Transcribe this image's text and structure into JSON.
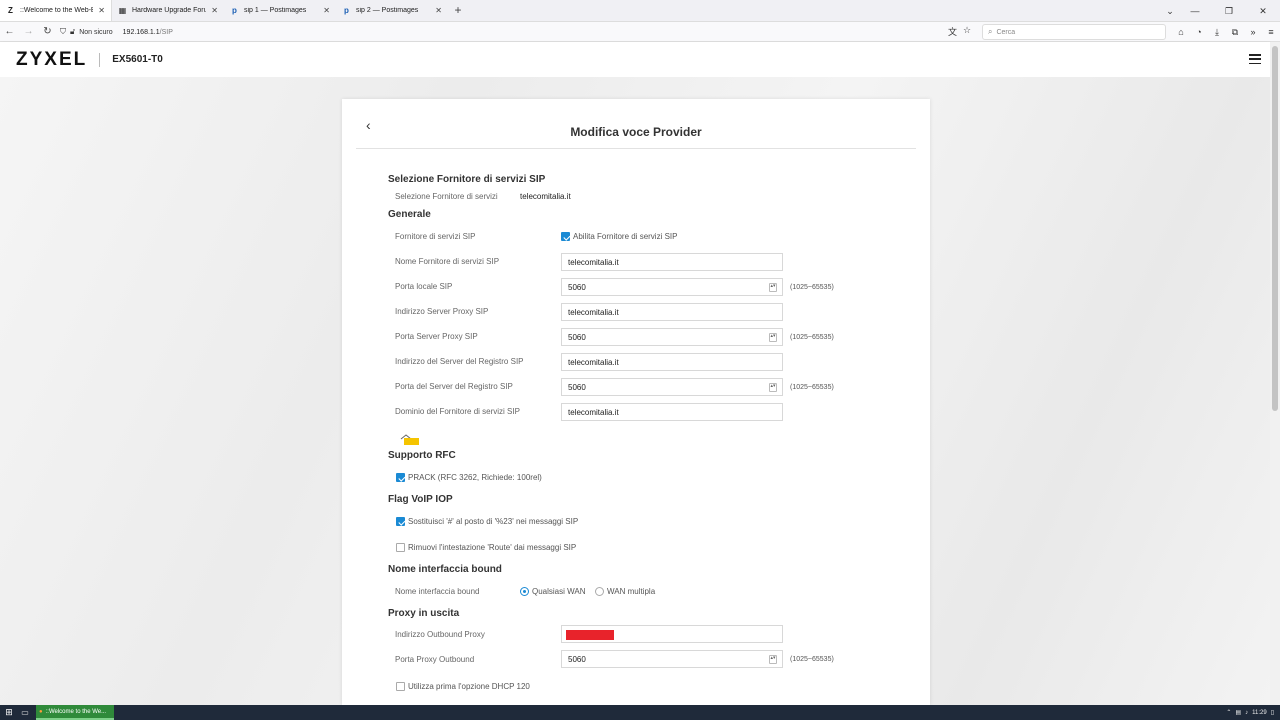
{
  "browser": {
    "tabs": [
      {
        "favicon": "Z",
        "title": "::Welcome to the Web-Based C",
        "active": true
      },
      {
        "favicon": "▦",
        "title": "Hardware Upgrade Forum - Re",
        "active": false
      },
      {
        "favicon": "p",
        "title": "sip 1 — Postimages",
        "active": false
      },
      {
        "favicon": "p",
        "title": "sip 2 — Postimages",
        "active": false
      }
    ],
    "new_tab": "+",
    "security_label": "Non sicuro",
    "url_host": "192.168.1.1",
    "url_path": "/SIP",
    "search_placeholder": "Cerca"
  },
  "header": {
    "logo": "ZYXEL",
    "model": "EX5601-T0"
  },
  "card": {
    "title": "Modifica voce Provider",
    "sip_selection": {
      "heading": "Selezione Fornitore di servizi SIP",
      "label": "Selezione Fornitore di servizi",
      "value": "telecomitalia.it"
    },
    "general": {
      "heading": "Generale",
      "provider_label": "Fornitore di servizi SIP",
      "enable_label": "Abilita Fornitore di servizi SIP",
      "name_label": "Nome Fornitore di servizi SIP",
      "name_value": "telecomitalia.it",
      "local_port_label": "Porta locale SIP",
      "local_port_value": "5060",
      "local_port_hint": "(1025~65535)",
      "proxy_addr_label": "Indirizzo Server Proxy SIP",
      "proxy_addr_value": "telecomitalia.it",
      "proxy_port_label": "Porta Server Proxy SIP",
      "proxy_port_value": "5060",
      "proxy_port_hint": "(1025~65535)",
      "registrar_addr_label": "Indirizzo del Server del Registro SIP",
      "registrar_addr_value": "telecomitalia.it",
      "registrar_port_label": "Porta del Server del Registro SIP",
      "registrar_port_value": "5060",
      "registrar_port_hint": "(1025~65535)",
      "domain_label": "Dominio del Fornitore di servizi SIP",
      "domain_value": "telecomitalia.it"
    },
    "rfc": {
      "heading": "Supporto RFC",
      "prack_label": "PRACK (RFC 3262, Richiede: 100rel)"
    },
    "voip_iop": {
      "heading": "Flag VoIP IOP",
      "replace_label": "Sostituisci '#' al posto di '%23' nei messaggi SIP",
      "remove_route_label": "Rimuovi l'intestazione 'Route' dai messaggi SIP"
    },
    "bound": {
      "heading": "Nome interfaccia bound",
      "label": "Nome interfaccia bound",
      "option_any": "Qualsiasi WAN",
      "option_multi": "WAN multipla"
    },
    "outbound": {
      "heading": "Proxy in uscita",
      "addr_label": "Indirizzo Outbound Proxy",
      "port_label": "Porta Proxy Outbound",
      "port_value": "5060",
      "port_hint": "(1025~65535)",
      "dhcp_label": "Utilizza prima l'opzione DHCP 120"
    }
  },
  "taskbar": {
    "app_label": "::Welcome to the We...",
    "time": "11:29"
  }
}
